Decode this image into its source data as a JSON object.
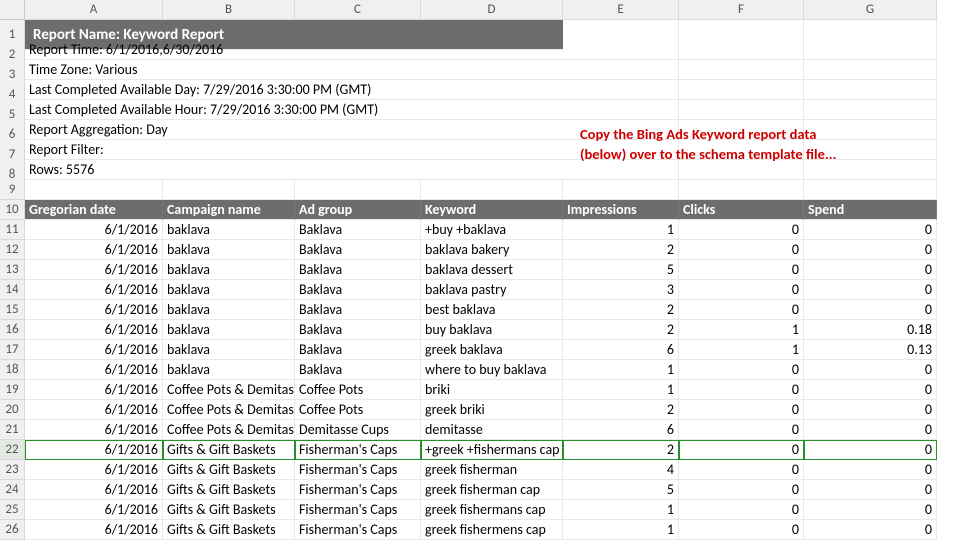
{
  "columns": [
    "A",
    "B",
    "C",
    "D",
    "E",
    "F",
    "G"
  ],
  "title": "Report Name: Keyword Report",
  "meta": [
    "Report Time: 6/1/2016,6/30/2016",
    "Time Zone: Various",
    "Last Completed Available Day: 7/29/2016 3:30:00 PM (GMT)",
    "Last Completed Available Hour: 7/29/2016 3:30:00 PM (GMT)",
    "Report Aggregation: Day",
    "Report Filter:",
    "Rows: 5576"
  ],
  "note_line1": "Copy the Bing Ads Keyword report data",
  "note_line2": "(below) over to the schema template file...",
  "headers": [
    "Gregorian date",
    "Campaign name",
    "Ad group",
    "Keyword",
    "Impressions",
    "Clicks",
    "Spend"
  ],
  "rows": [
    {
      "n": 11,
      "d": [
        "6/1/2016",
        "baklava",
        "Baklava",
        "+buy +baklava",
        "1",
        "0",
        "0"
      ]
    },
    {
      "n": 12,
      "d": [
        "6/1/2016",
        "baklava",
        "Baklava",
        "baklava bakery",
        "2",
        "0",
        "0"
      ]
    },
    {
      "n": 13,
      "d": [
        "6/1/2016",
        "baklava",
        "Baklava",
        "baklava dessert",
        "5",
        "0",
        "0"
      ]
    },
    {
      "n": 14,
      "d": [
        "6/1/2016",
        "baklava",
        "Baklava",
        "baklava pastry",
        "3",
        "0",
        "0"
      ]
    },
    {
      "n": 15,
      "d": [
        "6/1/2016",
        "baklava",
        "Baklava",
        "best baklava",
        "2",
        "0",
        "0"
      ]
    },
    {
      "n": 16,
      "d": [
        "6/1/2016",
        "baklava",
        "Baklava",
        "buy baklava",
        "2",
        "1",
        "0.18"
      ]
    },
    {
      "n": 17,
      "d": [
        "6/1/2016",
        "baklava",
        "Baklava",
        "greek baklava",
        "6",
        "1",
        "0.13"
      ]
    },
    {
      "n": 18,
      "d": [
        "6/1/2016",
        "baklava",
        "Baklava",
        "where to buy baklava",
        "1",
        "0",
        "0"
      ]
    },
    {
      "n": 19,
      "d": [
        "6/1/2016",
        "Coffee Pots & Demitasse Cups",
        "Coffee Pots",
        "briki",
        "1",
        "0",
        "0"
      ]
    },
    {
      "n": 20,
      "d": [
        "6/1/2016",
        "Coffee Pots & Demitasse Cups",
        "Coffee Pots",
        "greek briki",
        "2",
        "0",
        "0"
      ]
    },
    {
      "n": 21,
      "d": [
        "6/1/2016",
        "Coffee Pots & Demitasse Cups",
        "Demitasse Cups",
        "demitasse",
        "6",
        "0",
        "0"
      ]
    },
    {
      "n": 22,
      "d": [
        "6/1/2016",
        "Gifts & Gift Baskets",
        "Fisherman's Caps",
        "+greek +fishermans cap",
        "2",
        "0",
        "0"
      ]
    },
    {
      "n": 23,
      "d": [
        "6/1/2016",
        "Gifts & Gift Baskets",
        "Fisherman's Caps",
        "greek fisherman",
        "4",
        "0",
        "0"
      ]
    },
    {
      "n": 24,
      "d": [
        "6/1/2016",
        "Gifts & Gift Baskets",
        "Fisherman's Caps",
        "greek fisherman cap",
        "5",
        "0",
        "0"
      ]
    },
    {
      "n": 25,
      "d": [
        "6/1/2016",
        "Gifts & Gift Baskets",
        "Fisherman's Caps",
        "greek fishermans cap",
        "1",
        "0",
        "0"
      ]
    },
    {
      "n": 26,
      "d": [
        "6/1/2016",
        "Gifts & Gift Baskets",
        "Fisherman's Caps",
        "greek fishermens cap",
        "1",
        "0",
        "0"
      ]
    }
  ],
  "selected_row": 22
}
